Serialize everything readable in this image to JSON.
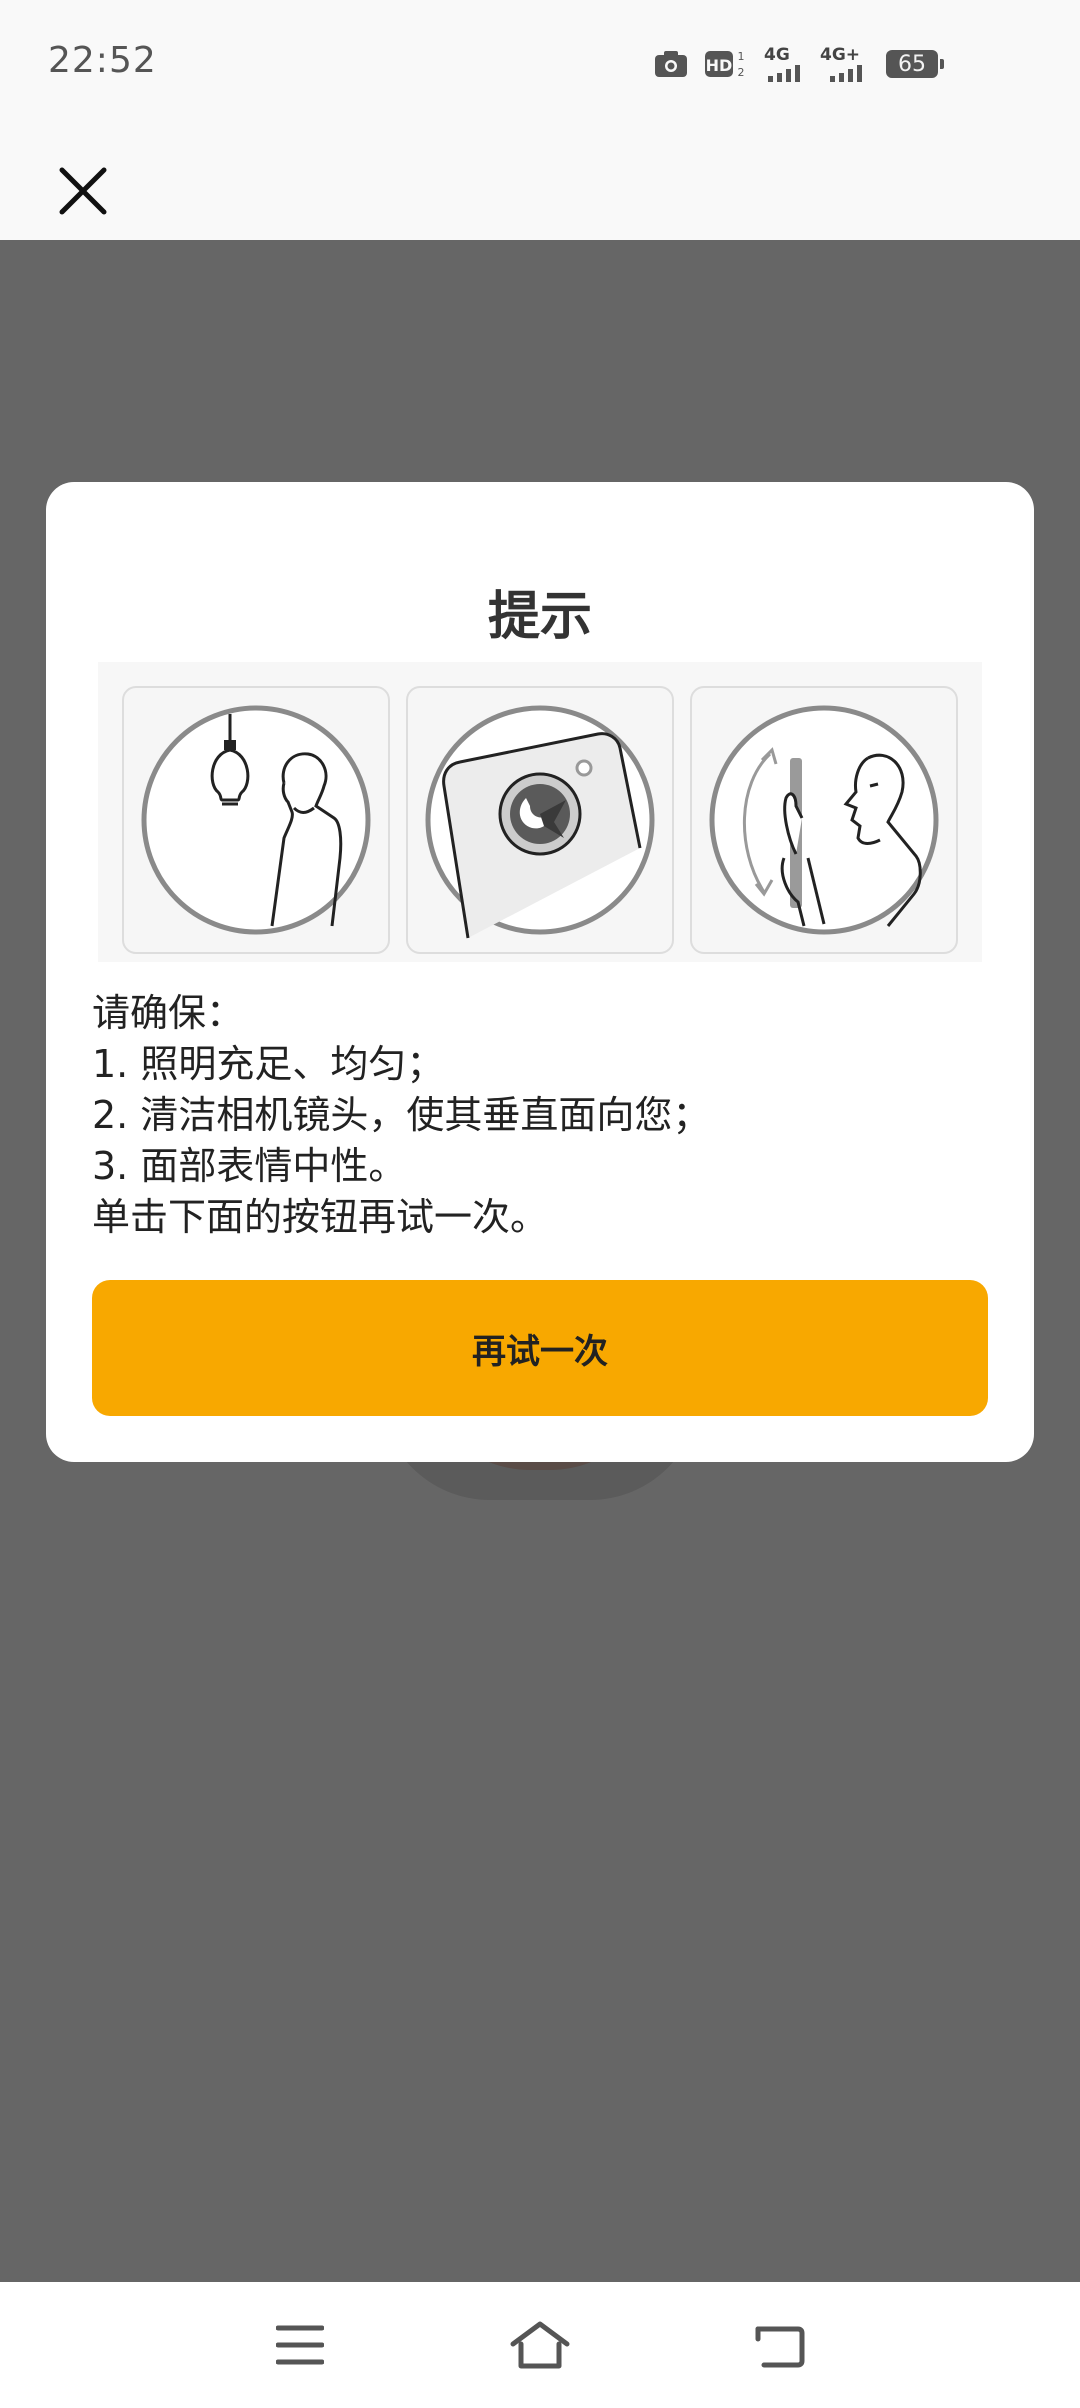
{
  "status_bar": {
    "time": "22:52",
    "icons": [
      "camera-icon",
      "hd-icon",
      "signal-4g-icon",
      "signal-4g-plus-icon",
      "battery-icon"
    ],
    "network_labels": [
      "4G",
      "4G+"
    ],
    "battery_level": "65"
  },
  "top_bar": {
    "close_icon": "close-icon"
  },
  "modal": {
    "title": "提示",
    "illustrations": [
      "lighting-illustration",
      "camera-lens-illustration",
      "vertical-phone-illustration"
    ],
    "instructions": {
      "intro": "请确保：",
      "item1": "1. 照明充足、均匀；",
      "item2": "2. 清洁相机镜头，使其垂直面向您；",
      "item3": "3. 面部表情中性。",
      "outro": "单击下面的按钮再试一次。"
    },
    "retry_label": "再试一次"
  },
  "nav_bar": {
    "icons": [
      "menu-icon",
      "home-icon",
      "back-icon"
    ]
  },
  "colors": {
    "accent": "#f8a800",
    "overlay": "#666666",
    "surface": "#ffffff",
    "bar_background": "#f9f9f9"
  }
}
